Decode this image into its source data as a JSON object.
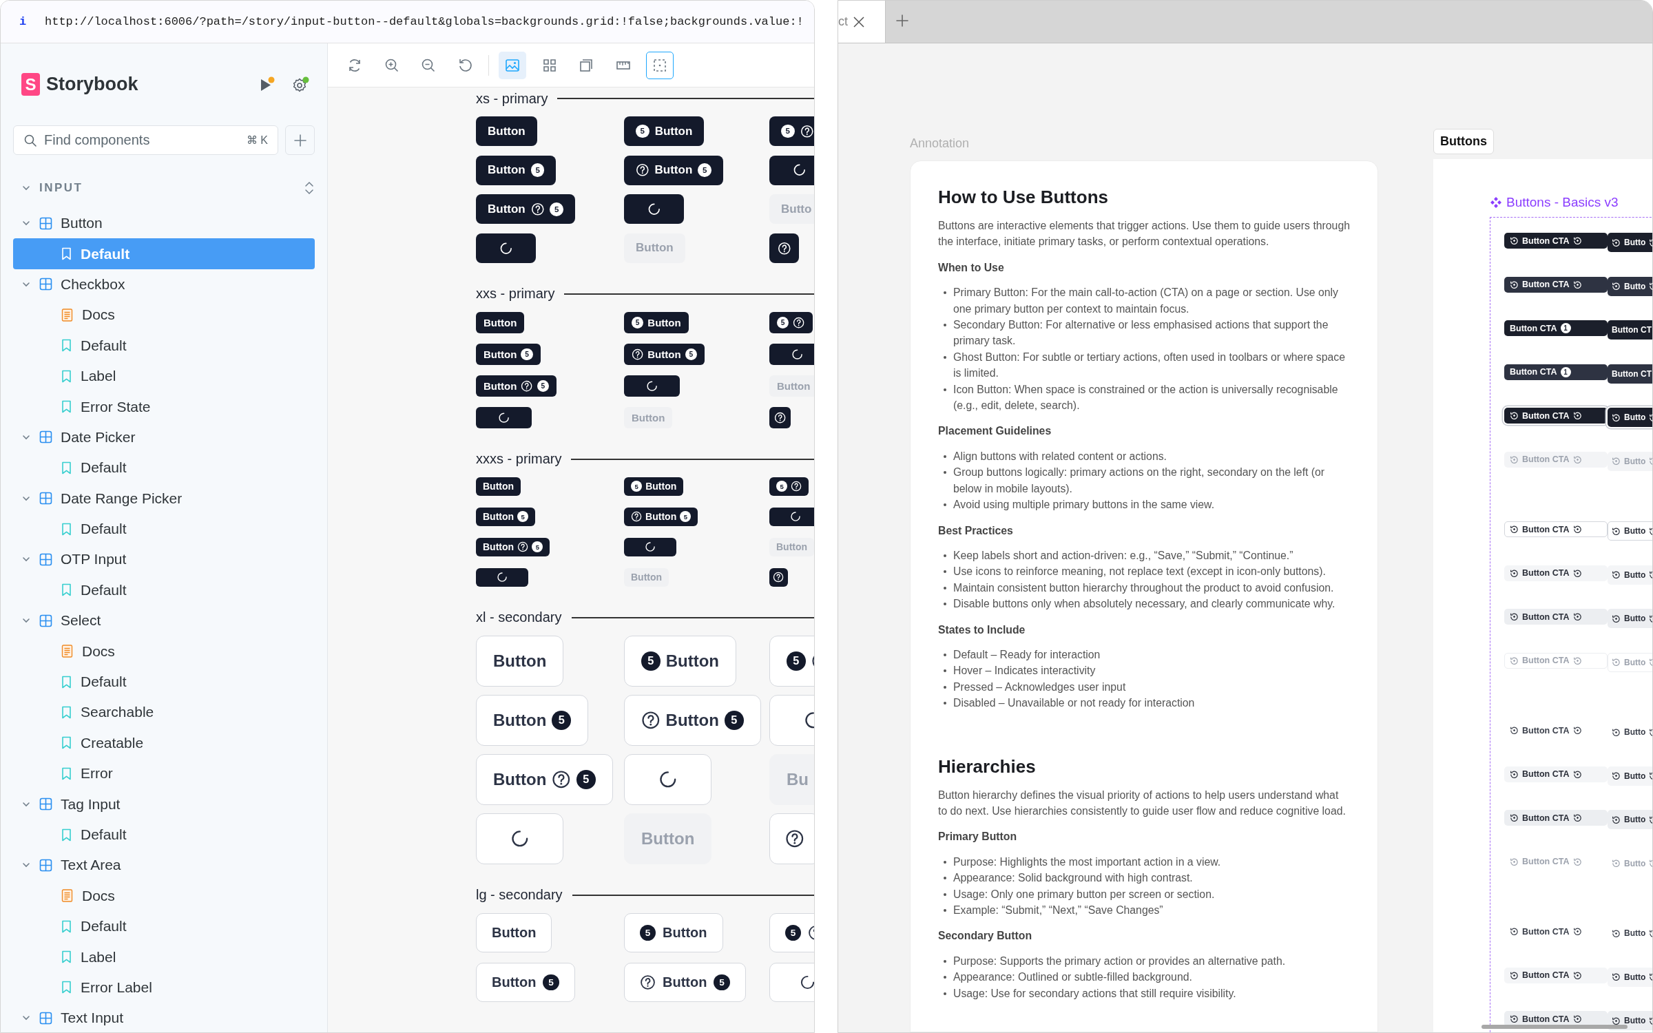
{
  "browser": {
    "info": "i",
    "url": "http://localhost:6006/?path=/story/input-button--default&globals=backgrounds.grid:!false;backgrounds.value:!"
  },
  "sidebar": {
    "logo_letter": "S",
    "brand": "Storybook",
    "search": {
      "placeholder": "Find components",
      "shortcut": "⌘ K"
    },
    "section": {
      "title": "INPUT",
      "expanded": true
    },
    "tree": [
      {
        "label": "Button",
        "expanded": true,
        "children": [
          {
            "label": "Default",
            "kind": "story",
            "selected": true
          }
        ]
      },
      {
        "label": "Checkbox",
        "expanded": true,
        "children": [
          {
            "label": "Docs",
            "kind": "docs",
            "selected": false
          },
          {
            "label": "Default",
            "kind": "story",
            "selected": false
          },
          {
            "label": "Label",
            "kind": "story",
            "selected": false
          },
          {
            "label": "Error State",
            "kind": "story",
            "selected": false
          }
        ]
      },
      {
        "label": "Date Picker",
        "expanded": true,
        "children": [
          {
            "label": "Default",
            "kind": "story",
            "selected": false
          }
        ]
      },
      {
        "label": "Date Range Picker",
        "expanded": true,
        "children": [
          {
            "label": "Default",
            "kind": "story",
            "selected": false
          }
        ]
      },
      {
        "label": "OTP Input",
        "expanded": true,
        "children": [
          {
            "label": "Default",
            "kind": "story",
            "selected": false
          }
        ]
      },
      {
        "label": "Select",
        "expanded": true,
        "children": [
          {
            "label": "Docs",
            "kind": "docs",
            "selected": false
          },
          {
            "label": "Default",
            "kind": "story",
            "selected": false
          },
          {
            "label": "Searchable",
            "kind": "story",
            "selected": false
          },
          {
            "label": "Creatable",
            "kind": "story",
            "selected": false
          },
          {
            "label": "Error",
            "kind": "story",
            "selected": false
          }
        ]
      },
      {
        "label": "Tag Input",
        "expanded": true,
        "children": [
          {
            "label": "Default",
            "kind": "story",
            "selected": false
          }
        ]
      },
      {
        "label": "Text Area",
        "expanded": true,
        "children": [
          {
            "label": "Docs",
            "kind": "docs",
            "selected": false
          },
          {
            "label": "Default",
            "kind": "story",
            "selected": false
          },
          {
            "label": "Label",
            "kind": "story",
            "selected": false
          },
          {
            "label": "Error Label",
            "kind": "story",
            "selected": false
          }
        ]
      },
      {
        "label": "Text Input",
        "expanded": true
      }
    ]
  },
  "toolbar": [
    {
      "active": false,
      "focused": false
    },
    {
      "active": false,
      "focused": false
    },
    {
      "active": false,
      "focused": false
    },
    {
      "active": false,
      "focused": false
    },
    {
      "active": true,
      "focused": false
    },
    {
      "active": false,
      "focused": false
    },
    {
      "active": false,
      "focused": false
    },
    {
      "active": false,
      "focused": false
    },
    {
      "active": false,
      "focused": true
    }
  ],
  "canvas": {
    "sections": [
      {
        "title": "xs - primary",
        "kind": "xs-primary",
        "rows": [
          [
            {
              "parts": [
                {
                  "kind": "text",
                  "text": "Button"
                }
              ],
              "disabled": false
            },
            {
              "parts": [
                {
                  "kind": "badge",
                  "text": "5"
                },
                {
                  "kind": "text",
                  "text": "Button"
                }
              ],
              "disabled": false
            },
            {
              "parts": [
                {
                  "kind": "badge",
                  "text": "5"
                },
                {
                  "kind": "help"
                }
              ],
              "disabled": false
            }
          ],
          [
            {
              "parts": [
                {
                  "kind": "text",
                  "text": "Button"
                },
                {
                  "kind": "badge",
                  "text": "5"
                }
              ],
              "disabled": false
            },
            {
              "parts": [
                {
                  "kind": "help"
                },
                {
                  "kind": "text",
                  "text": "Button"
                },
                {
                  "kind": "badge",
                  "text": "5"
                }
              ],
              "disabled": false
            },
            {
              "parts": [
                {
                  "kind": "spinner"
                }
              ],
              "disabled": false
            }
          ],
          [
            {
              "parts": [
                {
                  "kind": "text",
                  "text": "Button"
                },
                {
                  "kind": "help"
                },
                {
                  "kind": "badge",
                  "text": "5"
                }
              ],
              "disabled": false
            },
            {
              "parts": [
                {
                  "kind": "spinner"
                }
              ],
              "disabled": false
            },
            {
              "parts": [
                {
                  "kind": "text",
                  "text": "Butto"
                }
              ],
              "disabled": true
            }
          ],
          [
            {
              "parts": [
                {
                  "kind": "spinner"
                }
              ],
              "disabled": false
            },
            {
              "parts": [
                {
                  "kind": "text",
                  "text": "Button"
                }
              ],
              "disabled": true
            },
            {
              "parts": [
                {
                  "kind": "help"
                }
              ],
              "disabled": false
            }
          ]
        ]
      },
      {
        "title": "xxs - primary",
        "kind": "xxs-primary",
        "rows": [
          [
            {
              "parts": [
                {
                  "kind": "text",
                  "text": "Button"
                }
              ],
              "disabled": false
            },
            {
              "parts": [
                {
                  "kind": "badge",
                  "text": "5"
                },
                {
                  "kind": "text",
                  "text": "Button"
                }
              ],
              "disabled": false
            },
            {
              "parts": [
                {
                  "kind": "badge",
                  "text": "5"
                },
                {
                  "kind": "help"
                }
              ],
              "disabled": false
            }
          ],
          [
            {
              "parts": [
                {
                  "kind": "text",
                  "text": "Button"
                },
                {
                  "kind": "badge",
                  "text": "5"
                }
              ],
              "disabled": false
            },
            {
              "parts": [
                {
                  "kind": "help"
                },
                {
                  "kind": "text",
                  "text": "Button"
                },
                {
                  "kind": "badge",
                  "text": "5"
                }
              ],
              "disabled": false
            },
            {
              "parts": [
                {
                  "kind": "spinner"
                }
              ],
              "disabled": false
            }
          ],
          [
            {
              "parts": [
                {
                  "kind": "text",
                  "text": "Button"
                },
                {
                  "kind": "help"
                },
                {
                  "kind": "badge",
                  "text": "5"
                }
              ],
              "disabled": false
            },
            {
              "parts": [
                {
                  "kind": "spinner"
                }
              ],
              "disabled": false
            },
            {
              "parts": [
                {
                  "kind": "text",
                  "text": "Button"
                }
              ],
              "disabled": true
            }
          ],
          [
            {
              "parts": [
                {
                  "kind": "spinner"
                }
              ],
              "disabled": false
            },
            {
              "parts": [
                {
                  "kind": "text",
                  "text": "Button"
                }
              ],
              "disabled": true
            },
            {
              "parts": [
                {
                  "kind": "help"
                }
              ],
              "disabled": false
            }
          ]
        ]
      },
      {
        "title": "xxxs - primary",
        "kind": "xxxs-primary",
        "rows": [
          [
            {
              "parts": [
                {
                  "kind": "text",
                  "text": "Button"
                }
              ],
              "disabled": false
            },
            {
              "parts": [
                {
                  "kind": "badge",
                  "text": "5"
                },
                {
                  "kind": "text",
                  "text": "Button"
                }
              ],
              "disabled": false
            },
            {
              "parts": [
                {
                  "kind": "badge",
                  "text": "5"
                },
                {
                  "kind": "help"
                }
              ],
              "disabled": false
            }
          ],
          [
            {
              "parts": [
                {
                  "kind": "text",
                  "text": "Button"
                },
                {
                  "kind": "badge",
                  "text": "5"
                }
              ],
              "disabled": false
            },
            {
              "parts": [
                {
                  "kind": "help"
                },
                {
                  "kind": "text",
                  "text": "Button"
                },
                {
                  "kind": "badge",
                  "text": "5"
                }
              ],
              "disabled": false
            },
            {
              "parts": [
                {
                  "kind": "spinner"
                }
              ],
              "disabled": false
            }
          ],
          [
            {
              "parts": [
                {
                  "kind": "text",
                  "text": "Button"
                },
                {
                  "kind": "help"
                },
                {
                  "kind": "badge",
                  "text": "5"
                }
              ],
              "disabled": false
            },
            {
              "parts": [
                {
                  "kind": "spinner"
                }
              ],
              "disabled": false
            },
            {
              "parts": [
                {
                  "kind": "text",
                  "text": "Button"
                }
              ],
              "disabled": true
            }
          ],
          [
            {
              "parts": [
                {
                  "kind": "spinner"
                }
              ],
              "disabled": false
            },
            {
              "parts": [
                {
                  "kind": "text",
                  "text": "Button"
                }
              ],
              "disabled": true
            },
            {
              "parts": [
                {
                  "kind": "help"
                }
              ],
              "disabled": false
            }
          ]
        ]
      },
      {
        "title": "xl - secondary",
        "kind": "xl-secondary",
        "rows": [
          [
            {
              "parts": [
                {
                  "kind": "text",
                  "text": "Button"
                }
              ],
              "disabled": false
            },
            {
              "parts": [
                {
                  "kind": "badge",
                  "text": "5"
                },
                {
                  "kind": "text",
                  "text": "Button"
                }
              ],
              "disabled": false
            },
            {
              "parts": [
                {
                  "kind": "badge",
                  "text": "5"
                },
                {
                  "kind": "help"
                }
              ],
              "disabled": false
            }
          ],
          [
            {
              "parts": [
                {
                  "kind": "text",
                  "text": "Button"
                },
                {
                  "kind": "badge",
                  "text": "5"
                }
              ],
              "disabled": false
            },
            {
              "parts": [
                {
                  "kind": "help"
                },
                {
                  "kind": "text",
                  "text": "Button"
                },
                {
                  "kind": "badge",
                  "text": "5"
                }
              ],
              "disabled": false
            },
            {
              "parts": [
                {
                  "kind": "spinner"
                }
              ],
              "disabled": false
            }
          ],
          [
            {
              "parts": [
                {
                  "kind": "text",
                  "text": "Button"
                },
                {
                  "kind": "help"
                },
                {
                  "kind": "badge",
                  "text": "5"
                }
              ],
              "disabled": false
            },
            {
              "parts": [
                {
                  "kind": "spinner"
                }
              ],
              "disabled": false
            },
            {
              "parts": [
                {
                  "kind": "text",
                  "text": "Bu"
                }
              ],
              "disabled": true
            }
          ],
          [
            {
              "parts": [
                {
                  "kind": "spinner"
                }
              ],
              "disabled": false
            },
            {
              "parts": [
                {
                  "kind": "text",
                  "text": "Button"
                }
              ],
              "disabled": true
            },
            {
              "parts": [
                {
                  "kind": "help"
                }
              ],
              "disabled": false
            }
          ]
        ]
      },
      {
        "title": "lg - secondary",
        "kind": "lg-secondary",
        "rows": [
          [
            {
              "parts": [
                {
                  "kind": "text",
                  "text": "Button"
                }
              ],
              "disabled": false
            },
            {
              "parts": [
                {
                  "kind": "badge",
                  "text": "5"
                },
                {
                  "kind": "text",
                  "text": "Button"
                }
              ],
              "disabled": false
            },
            {
              "parts": [
                {
                  "kind": "badge",
                  "text": "5"
                },
                {
                  "kind": "help"
                }
              ],
              "disabled": false
            }
          ],
          [
            {
              "parts": [
                {
                  "kind": "text",
                  "text": "Button"
                },
                {
                  "kind": "badge",
                  "text": "5"
                }
              ],
              "disabled": false
            },
            {
              "parts": [
                {
                  "kind": "help"
                },
                {
                  "kind": "text",
                  "text": "Button"
                },
                {
                  "kind": "badge",
                  "text": "5"
                }
              ],
              "disabled": false
            },
            {
              "parts": [
                {
                  "kind": "spinner"
                }
              ],
              "disabled": false
            }
          ]
        ]
      }
    ]
  },
  "design_tool": {
    "tab": {
      "title": "ct"
    },
    "annotation": {
      "label": "Annotation",
      "sections": [
        {
          "heading": "How to Use Buttons",
          "intro": "Buttons are interactive elements that trigger actions. Use them to guide users through the interface, initiate primary tasks, or perform contextual operations.",
          "groups": [
            {
              "title": "When to Use",
              "items": [
                "Primary Button: For the main call-to-action (CTA) on a page or section. Use only one primary button per context to maintain focus.",
                "Secondary Button: For alternative or less emphasised actions that support the primary task.",
                "Ghost Button: For subtle or tertiary actions, often used in toolbars or where space is limited.",
                "Icon Button: When space is constrained or the action is universally recognisable (e.g., edit, delete, search)."
              ]
            },
            {
              "title": "Placement Guidelines",
              "items": [
                "Align buttons with related content or actions.",
                "Group buttons logically: primary actions on the right, secondary on the left (or below in mobile layouts).",
                "Avoid using multiple primary buttons in the same view."
              ]
            },
            {
              "title": "Best Practices",
              "items": [
                "Keep labels short and action-driven: e.g., “Save,” “Submit,” “Continue.”",
                "Use icons to reinforce meaning, not replace text (except in icon-only buttons).",
                "Maintain consistent button hierarchy throughout the product to avoid confusion.",
                "Disable buttons only when absolutely necessary, and clearly communicate why."
              ]
            },
            {
              "title": "States to Include",
              "items": [
                "Default – Ready for interaction",
                "Hover – Indicates interactivity",
                "Pressed – Acknowledges user input",
                "Disabled – Unavailable or not ready for interaction"
              ]
            }
          ]
        },
        {
          "heading": "Hierarchies",
          "intro": "Button hierarchy defines the visual priority of actions to help users understand what to do next. Use hierarchies consistently to guide user flow and reduce cognitive load.",
          "groups": [
            {
              "title": "Primary Button",
              "items": [
                "Purpose: Highlights the most important action in a view.",
                "Appearance: Solid background with high contrast.",
                "Usage: Only one primary button per screen or section.",
                "Example: “Submit,” “Next,” “Save Changes”"
              ]
            },
            {
              "title": "Secondary Button",
              "items": [
                "Purpose: Supports the primary action or provides an alternative path.",
                "Appearance: Outlined or subtle-filled background.",
                "Usage: Use for secondary actions that still require visibility."
              ]
            }
          ]
        }
      ]
    },
    "frame": {
      "tag": "Buttons",
      "title": "Buttons - Basics v3",
      "groups": [
        {
          "rows": [
            {
              "kind": "dark",
              "cells": [
                {
                  "kind": "icons",
                  "label": "Button CTA"
                },
                {
                  "kind": "icons",
                  "label": "Butto"
                }
              ]
            },
            {
              "kind": "dark-hover",
              "cells": [
                {
                  "kind": "icons",
                  "label": "Button CTA"
                },
                {
                  "kind": "icons",
                  "label": "Butto"
                }
              ]
            },
            {
              "kind": "dark",
              "cells": [
                {
                  "kind": "badge",
                  "label": "Button CTA",
                  "badge": "1"
                },
                {
                  "kind": "text",
                  "label": "Button CT"
                }
              ]
            },
            {
              "kind": "dark-hover",
              "cells": [
                {
                  "kind": "badge",
                  "label": "Button CTA",
                  "badge": "1"
                },
                {
                  "kind": "text",
                  "label": "Button CT"
                }
              ]
            },
            {
              "kind": "dark-focus",
              "cells": [
                {
                  "kind": "icons",
                  "label": "Button CTA"
                },
                {
                  "kind": "icons",
                  "label": "Butto"
                }
              ]
            },
            {
              "kind": "dark-disabled",
              "cells": [
                {
                  "kind": "icons",
                  "label": "Button CTA"
                },
                {
                  "kind": "icons",
                  "label": "Butto"
                }
              ]
            }
          ]
        },
        {
          "rows": [
            {
              "kind": "outline",
              "cells": [
                {
                  "kind": "icons",
                  "label": "Button CTA"
                },
                {
                  "kind": "icons",
                  "label": "Butto"
                }
              ]
            },
            {
              "kind": "subtle",
              "cells": [
                {
                  "kind": "icons",
                  "label": "Button CTA"
                },
                {
                  "kind": "icons",
                  "label": "Butto"
                }
              ]
            },
            {
              "kind": "pressed",
              "cells": [
                {
                  "kind": "icons",
                  "label": "Button CTA"
                },
                {
                  "kind": "icons",
                  "label": "Butto"
                }
              ]
            },
            {
              "kind": "outline-disabled",
              "cells": [
                {
                  "kind": "icons",
                  "label": "Button CTA"
                },
                {
                  "kind": "icons",
                  "label": "Butto"
                }
              ]
            }
          ]
        },
        {
          "rows": [
            {
              "kind": "ghost",
              "cells": [
                {
                  "kind": "icons",
                  "label": "Button CTA"
                },
                {
                  "kind": "icons",
                  "label": "Butto"
                }
              ]
            },
            {
              "kind": "subtle",
              "cells": [
                {
                  "kind": "icons",
                  "label": "Button CTA"
                },
                {
                  "kind": "icons",
                  "label": "Butto"
                }
              ]
            },
            {
              "kind": "pressed",
              "cells": [
                {
                  "kind": "icons",
                  "label": "Button CTA"
                },
                {
                  "kind": "icons",
                  "label": "Butto"
                }
              ]
            },
            {
              "kind": "ghost-disabled",
              "cells": [
                {
                  "kind": "icons",
                  "label": "Button CTA"
                },
                {
                  "kind": "icons",
                  "label": "Butto"
                }
              ]
            }
          ]
        },
        {
          "rows": [
            {
              "kind": "ghost",
              "cells": [
                {
                  "kind": "icons",
                  "label": "Button CTA"
                },
                {
                  "kind": "icons",
                  "label": "Butto"
                }
              ]
            },
            {
              "kind": "subtle",
              "cells": [
                {
                  "kind": "icons",
                  "label": "Button CTA"
                },
                {
                  "kind": "icons",
                  "label": "Butto"
                }
              ]
            },
            {
              "kind": "pressed",
              "cells": [
                {
                  "kind": "icons",
                  "label": "Button CTA"
                },
                {
                  "kind": "icons",
                  "label": "Butto"
                }
              ]
            }
          ]
        }
      ]
    }
  }
}
